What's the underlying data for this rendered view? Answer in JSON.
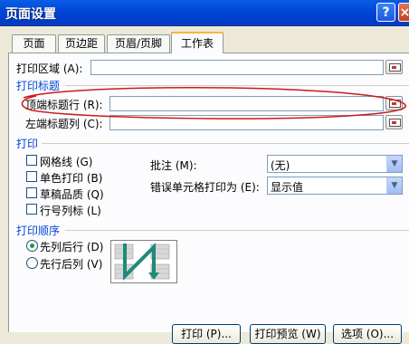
{
  "window": {
    "title": "页面设置",
    "help": "?",
    "close": "×"
  },
  "tabs": [
    "页面",
    "页边距",
    "页眉/页脚",
    "工作表"
  ],
  "print_area": {
    "label": "打印区域 (A):"
  },
  "print_titles": {
    "section": "打印标题",
    "top_rows": "顶端标题行 (R):",
    "left_cols": "左端标题列 (C):"
  },
  "print": {
    "section": "打印",
    "checkboxes": [
      "网格线 (G)",
      "单色打印 (B)",
      "草稿品质 (Q)",
      "行号列标 (L)"
    ],
    "comments_label": "批注 (M):",
    "comments_value": "(无)",
    "errors_label": "错误单元格打印为 (E):",
    "errors_value": "显示值"
  },
  "order": {
    "section": "打印顺序",
    "options": [
      "先列后行 (D)",
      "先行后列 (V)"
    ],
    "selected": 0
  },
  "buttons": [
    "打印 (P)...",
    "打印预览 (W)",
    "选项 (O)..."
  ],
  "annotation_color": "#cc1a1a"
}
